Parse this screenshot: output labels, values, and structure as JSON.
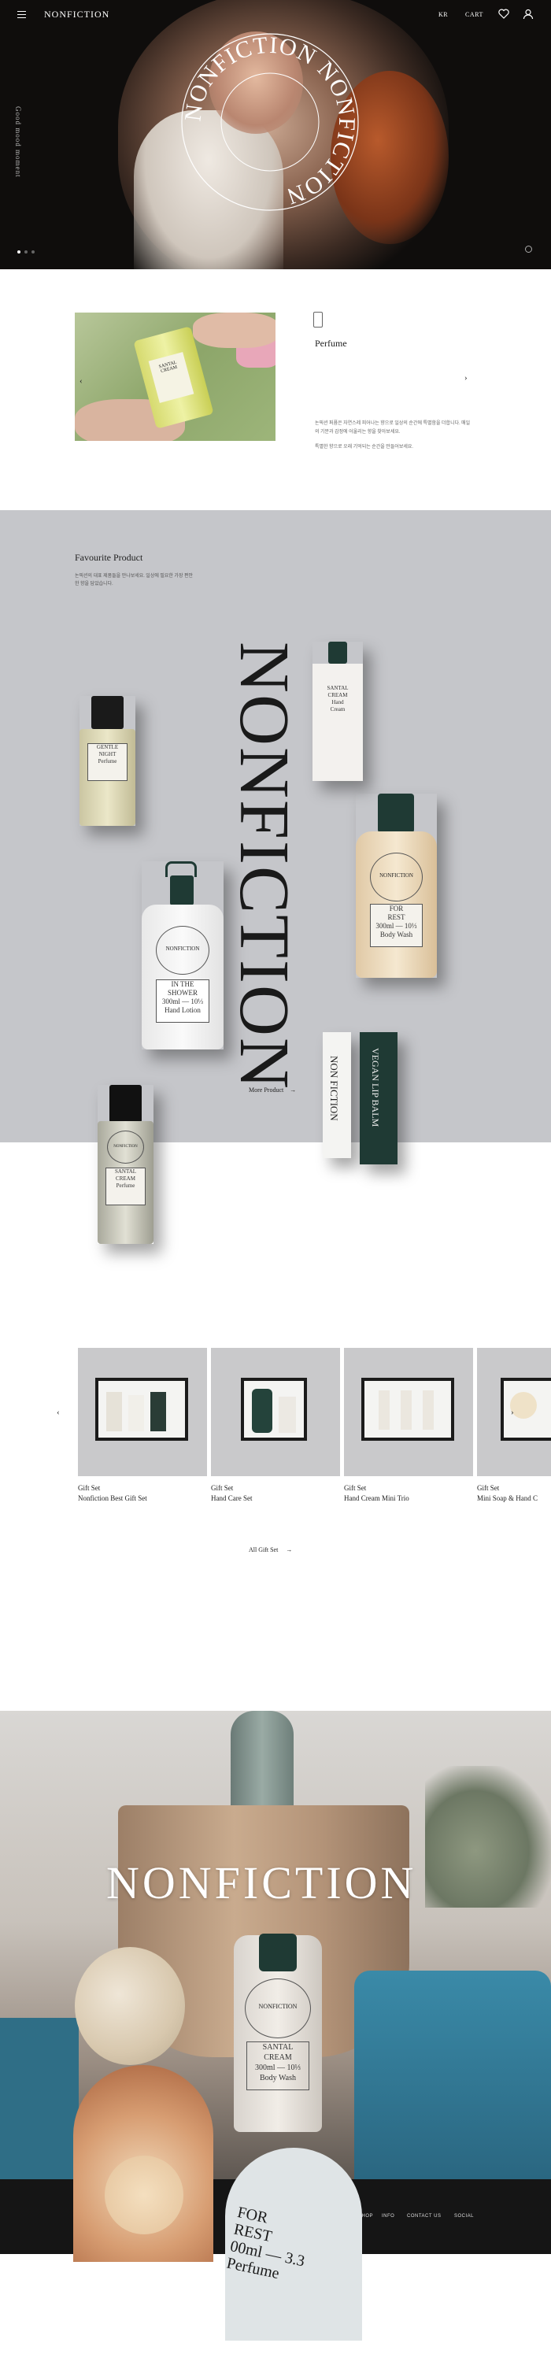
{
  "header": {
    "logo": "NONFICTION",
    "nav_kr": "KR",
    "nav_cart": "CART",
    "vertical_text": "Good mood moment"
  },
  "hero": {
    "seal_text": "NONFICTION NONFICTION ",
    "slide_count": 3,
    "active_slide": 1
  },
  "perfume": {
    "title": "Perfume",
    "prev": "‹",
    "next": "›",
    "desc_1": "논픽션 퍼퓸은 자연스레 피어나는 향으로 일상의 순간에 특별함을 더합니다. 매일의 기분과 감정에 어울리는 향을 찾아보세요.",
    "desc_2": "특별한 향으로 오래 기억되는 순간을 만들어보세요.",
    "bottle_label": "SANTAL CREAM"
  },
  "favourite": {
    "title": "Favourite Product",
    "desc": "논픽션의 대표 제품들을 만나보세요. 일상에 필요한 가장 편안한 향을 담았습니다.",
    "big_word": "NONFICTION",
    "more_label": "More Product",
    "arrow": "→",
    "products": {
      "gentle_night": [
        "GENTLE",
        "NIGHT",
        "Perfume"
      ],
      "santal_cream_hand": [
        "SANTAL",
        "CREAM",
        "Hand",
        "Cream"
      ],
      "for_rest": [
        "FOR",
        "REST",
        "300ml — 10⅓",
        "Body Wash"
      ],
      "in_the_shower": [
        "IN THE",
        "SHOWER",
        "300ml — 10⅓",
        "Hand Lotion"
      ],
      "santal_cream_perfume": [
        "SANTAL",
        "CREAM",
        "Perfume"
      ],
      "lip_white": "NON FICTION",
      "lip_green": "VEGAN LIP BALM",
      "seal_word": "NONFICTION"
    }
  },
  "gift": {
    "prev": "‹",
    "next": "›",
    "items": [
      {
        "category": "Gift Set",
        "name": "Nonfiction Best Gift Set"
      },
      {
        "category": "Gift Set",
        "name": "Hand Care Set"
      },
      {
        "category": "Gift Set",
        "name": "Hand Cream Mini Trio"
      },
      {
        "category": "Gift Set",
        "name": "Mini Soap & Hand C"
      }
    ],
    "all_label": "All Gift Set",
    "arrow": "→"
  },
  "brand": {
    "word": "NONFICTION",
    "bottle_label": [
      "SANTAL",
      "CREAM",
      "300ml — 10⅓",
      "Body Wash"
    ],
    "arch_text": "FOR\nREST\n00ml — 3.3\nPerfume"
  },
  "footer": {
    "nav": [
      "SHOP",
      "INFO",
      "CONTACT US",
      "SOCIAL"
    ]
  }
}
